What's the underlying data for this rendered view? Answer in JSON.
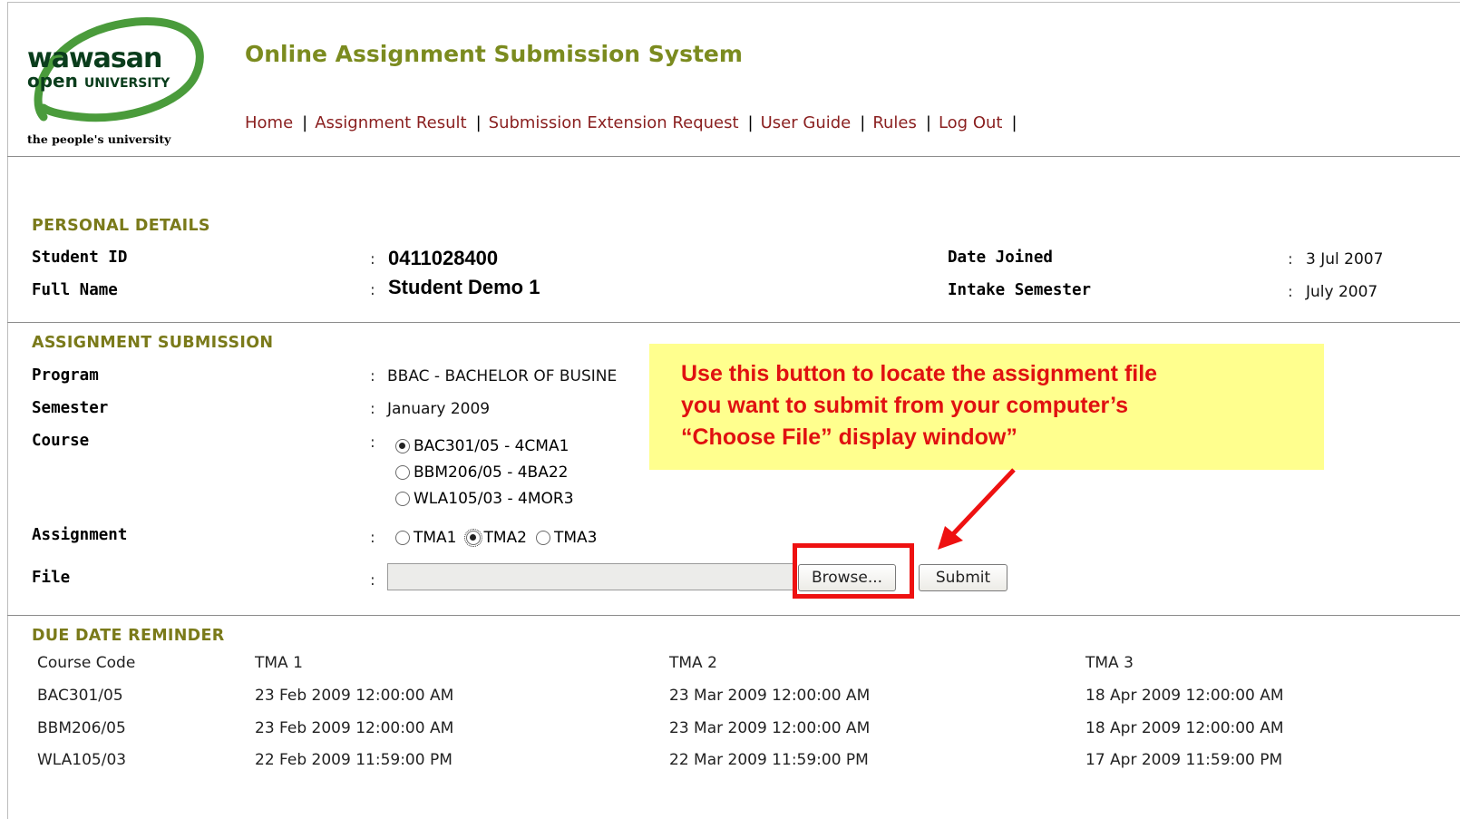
{
  "logo": {
    "word1": "wawasan",
    "word2": "open",
    "word2_sub": "UNIVERSITY",
    "tagline": "the people's university",
    "colors": {
      "swoosh": "#4a9b3b",
      "text": "#0a3d1c"
    }
  },
  "header": {
    "title": "Online Assignment Submission System",
    "nav": [
      {
        "label": "Home"
      },
      {
        "label": "Assignment Result"
      },
      {
        "label": "Submission Extension Request"
      },
      {
        "label": "User Guide"
      },
      {
        "label": "Rules"
      },
      {
        "label": "Log Out"
      }
    ],
    "separator": "|"
  },
  "personal": {
    "section_title": "PERSONAL DETAILS",
    "student_id_label": "Student ID",
    "student_id": "0411028400",
    "full_name_label": "Full Name",
    "full_name": "Student Demo 1",
    "date_joined_label": "Date Joined",
    "date_joined": "3 Jul 2007",
    "intake_label": "Intake Semester",
    "intake": "July 2007",
    "colon": ":"
  },
  "submission": {
    "section_title": "ASSIGNMENT SUBMISSION",
    "program_label": "Program",
    "program": "BBAC - BACHELOR OF BUSINE",
    "semester_label": "Semester",
    "semester": "January 2009",
    "course_label": "Course",
    "courses": [
      {
        "label": "BAC301/05 - 4CMA1",
        "checked": true
      },
      {
        "label": "BBM206/05 - 4BA22",
        "checked": false
      },
      {
        "label": "WLA105/03 - 4MOR3",
        "checked": false
      }
    ],
    "assignment_label": "Assignment",
    "assignments": [
      {
        "label": "TMA1",
        "checked": false
      },
      {
        "label": "TMA2",
        "checked": true
      },
      {
        "label": "TMA3",
        "checked": false
      }
    ],
    "file_label": "File",
    "file_value": "",
    "browse_label": "Browse...",
    "submit_label": "Submit"
  },
  "callout": {
    "lines": [
      "Use this button to locate the assignment file",
      "you want to submit from your computer’s",
      "“Choose File” display window”"
    ],
    "colors": {
      "background": "#ffff8e",
      "text": "#e01010",
      "arrow": "#ee1111"
    }
  },
  "due": {
    "section_title": "DUE DATE REMINDER",
    "headers": [
      "Course Code",
      "TMA 1",
      "TMA 2",
      "TMA 3"
    ],
    "rows": [
      [
        "BAC301/05",
        "23 Feb 2009 12:00:00 AM",
        "23 Mar 2009 12:00:00 AM",
        "18 Apr 2009 12:00:00 AM"
      ],
      [
        "BBM206/05",
        "23 Feb 2009 12:00:00 AM",
        "23 Mar 2009 12:00:00 AM",
        "18 Apr 2009 12:00:00 AM"
      ],
      [
        "WLA105/03",
        "22 Feb 2009 11:59:00 PM",
        "22 Mar 2009 11:59:00 PM",
        "17 Apr 2009 11:59:00 PM"
      ]
    ]
  }
}
